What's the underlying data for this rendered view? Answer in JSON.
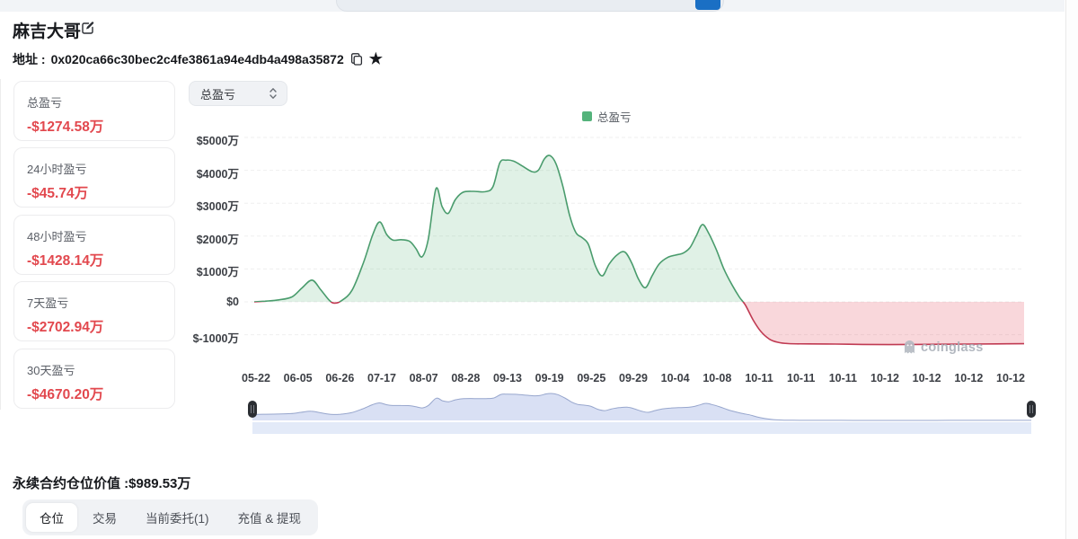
{
  "header": {
    "title": "麻吉大哥",
    "address_label": "地址 :",
    "address": "0x020ca66c30bec2c4fe3861a94e4db4a498a35872"
  },
  "stat_cards": [
    {
      "label": "总盈亏",
      "value": "-$1274.58万"
    },
    {
      "label": "24小时盈亏",
      "value": "-$45.74万"
    },
    {
      "label": "48小时盈亏",
      "value": "-$1428.14万"
    },
    {
      "label": "7天盈亏",
      "value": "-$2702.94万"
    },
    {
      "label": "30天盈亏",
      "value": "-$4670.20万"
    }
  ],
  "chart_controls": {
    "metric_select_value": "总盈亏"
  },
  "chart_data": {
    "type": "area",
    "title": "",
    "legend": [
      "总盈亏"
    ],
    "legend_position": "top-center",
    "grid": true,
    "y_ticks": [
      "$5000万",
      "$4000万",
      "$3000万",
      "$2000万",
      "$1000万",
      "$0",
      "$-1000万"
    ],
    "y_tick_values": [
      5000,
      4000,
      3000,
      2000,
      1000,
      0,
      -1000
    ],
    "ylim": [
      -1500,
      5200
    ],
    "y_unit": "万 USD",
    "x_ticks": [
      "05-22",
      "06-05",
      "06-26",
      "07-17",
      "08-07",
      "08-28",
      "09-13",
      "09-19",
      "09-25",
      "09-29",
      "10-04",
      "10-08",
      "10-11",
      "10-11",
      "10-11",
      "10-12",
      "10-12",
      "10-12",
      "10-12"
    ],
    "series": [
      {
        "name": "总盈亏",
        "points_format": "[x_fraction_of_plot_width, value_in_万USD]",
        "points": [
          [
            0.0,
            0
          ],
          [
            0.014,
            20
          ],
          [
            0.032,
            60
          ],
          [
            0.049,
            150
          ],
          [
            0.062,
            420
          ],
          [
            0.075,
            660
          ],
          [
            0.086,
            380
          ],
          [
            0.097,
            60
          ],
          [
            0.104,
            -40
          ],
          [
            0.113,
            30
          ],
          [
            0.127,
            350
          ],
          [
            0.142,
            1200
          ],
          [
            0.154,
            2050
          ],
          [
            0.163,
            2430
          ],
          [
            0.172,
            2050
          ],
          [
            0.18,
            1880
          ],
          [
            0.191,
            1890
          ],
          [
            0.202,
            1840
          ],
          [
            0.21,
            1620
          ],
          [
            0.218,
            1370
          ],
          [
            0.226,
            1900
          ],
          [
            0.236,
            3440
          ],
          [
            0.244,
            2900
          ],
          [
            0.252,
            2690
          ],
          [
            0.261,
            3100
          ],
          [
            0.271,
            3330
          ],
          [
            0.285,
            3360
          ],
          [
            0.3,
            3350
          ],
          [
            0.31,
            3500
          ],
          [
            0.319,
            4230
          ],
          [
            0.327,
            4310
          ],
          [
            0.337,
            4280
          ],
          [
            0.349,
            4120
          ],
          [
            0.361,
            3960
          ],
          [
            0.369,
            4000
          ],
          [
            0.377,
            4350
          ],
          [
            0.384,
            4450
          ],
          [
            0.392,
            4200
          ],
          [
            0.401,
            3500
          ],
          [
            0.41,
            2600
          ],
          [
            0.418,
            2100
          ],
          [
            0.426,
            1950
          ],
          [
            0.434,
            1750
          ],
          [
            0.443,
            1100
          ],
          [
            0.452,
            790
          ],
          [
            0.461,
            1150
          ],
          [
            0.471,
            1420
          ],
          [
            0.481,
            1520
          ],
          [
            0.49,
            1200
          ],
          [
            0.499,
            700
          ],
          [
            0.508,
            430
          ],
          [
            0.517,
            800
          ],
          [
            0.526,
            1150
          ],
          [
            0.537,
            1350
          ],
          [
            0.547,
            1420
          ],
          [
            0.557,
            1480
          ],
          [
            0.566,
            1650
          ],
          [
            0.574,
            2000
          ],
          [
            0.582,
            2350
          ],
          [
            0.59,
            2100
          ],
          [
            0.6,
            1600
          ],
          [
            0.61,
            1000
          ],
          [
            0.621,
            500
          ],
          [
            0.63,
            150
          ],
          [
            0.638,
            -100
          ],
          [
            0.648,
            -550
          ],
          [
            0.658,
            -900
          ],
          [
            0.669,
            -1130
          ],
          [
            0.68,
            -1230
          ],
          [
            0.694,
            -1270
          ],
          [
            0.72,
            -1280
          ],
          [
            0.755,
            -1285
          ],
          [
            0.79,
            -1295
          ],
          [
            0.825,
            -1300
          ],
          [
            0.86,
            -1295
          ],
          [
            0.895,
            -1290
          ],
          [
            0.93,
            -1285
          ],
          [
            0.965,
            -1278
          ],
          [
            1.0,
            -1272
          ]
        ]
      }
    ]
  },
  "colors": {
    "profit_line": "#4a9c6d",
    "profit_fill": "rgba(99,186,130,0.20)",
    "loss_line": "#c03a52",
    "loss_fill": "rgba(231,87,103,0.24)",
    "legend_green": "#54b37b",
    "value_red": "#e2484e",
    "accent_blue": "#1a6fc4",
    "nav_fill": "rgba(171,186,231,0.45)",
    "nav_line": "#97a6cd",
    "nav_band": "#e3eaf8",
    "grid_line": "#efefef"
  },
  "watermark": {
    "text": "coinglass"
  },
  "summary": {
    "text": "永续合约仓位价值 :$989.53万"
  },
  "tabs": [
    {
      "label": "仓位",
      "active": true
    },
    {
      "label": "交易",
      "active": false
    },
    {
      "label": "当前委托(1)",
      "active": false
    },
    {
      "label": "充值 & 提现",
      "active": false
    }
  ]
}
